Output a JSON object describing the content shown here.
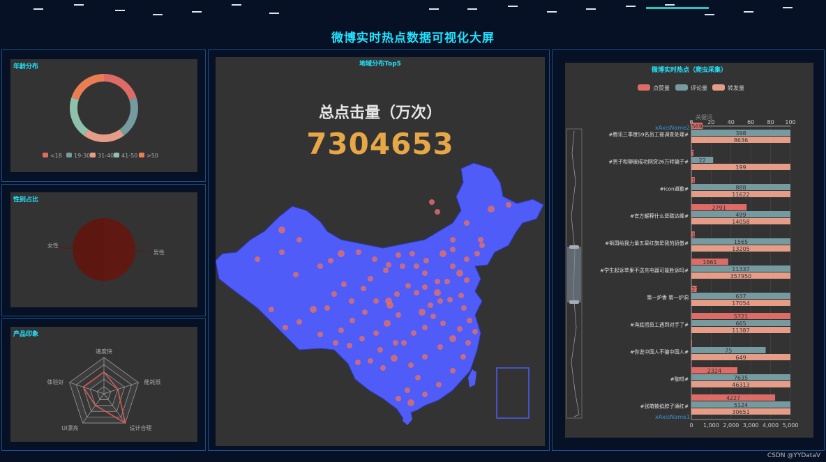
{
  "header": {
    "title": "微博实时热点数据可视化大屏"
  },
  "panels": {
    "age": {
      "title": "年龄分布"
    },
    "gender": {
      "title": "性别占比"
    },
    "impression": {
      "title": "产品印象"
    },
    "map": {
      "title": "地域分布Top5",
      "big_title": "总点击量（万次）",
      "big_number": "7304653"
    },
    "hot": {
      "title": "微博实时热点（爬虫采集）"
    }
  },
  "watermark": "CSDN @YYDataV",
  "colors": {
    "accent": "#1fe3ff",
    "panel_border": "#1b4f86",
    "map_fill": "#4f5cf8",
    "scatter": "#d96f6f",
    "number": "#e8a746"
  },
  "chart_data": [
    {
      "type": "pie",
      "id": "age",
      "variant": "donut",
      "categories": [
        "<18",
        "19-30",
        "31-40",
        "41-50",
        ">50"
      ],
      "values": [
        20,
        20,
        20,
        20,
        20
      ],
      "colors": [
        "#dd6b66",
        "#759aa0",
        "#e69d87",
        "#8dc1a9",
        "#ea7e53"
      ],
      "legend": "bottom"
    },
    {
      "type": "pie",
      "id": "gender",
      "categories": [
        "女性",
        "男性"
      ],
      "values": [
        50,
        50
      ],
      "colors": [
        "#5c1710",
        "#5f1812"
      ]
    },
    {
      "type": "radar",
      "id": "impression",
      "indicators": [
        "速度快",
        "能耗低",
        "设计合理",
        "UI漂亮",
        "体验好"
      ],
      "values": [
        3,
        2,
        5,
        2,
        3
      ],
      "max": 5
    },
    {
      "type": "scatter",
      "id": "map",
      "note": "scatter points over a map region"
    },
    {
      "type": "bar",
      "id": "hot",
      "orientation": "horizontal",
      "legend": "top",
      "xAxisName1": "xAxisName1",
      "xAxisName2": "xAxisName2",
      "yAxisName": "关键词",
      "bottom_ticks": [
        "0",
        "1,000",
        "2,000",
        "3,000",
        "4,000",
        "5,000"
      ],
      "top_ticks": [
        "0",
        "20",
        "40",
        "60",
        "80",
        "100"
      ],
      "categories": [
        "#腾讯三季度59名员工被调查处理#",
        "#男子和聊被成功网贷26万转骗子#",
        "#icon道歉#",
        "#官方解释什么是碳达峰#",
        "#祖国给我力量五星红旗是我的骄傲#",
        "#学生起诉苹果不送充电器可能胜诉吗#",
        "第一炉香 第一炉洞",
        "#海底捞员工遇到对手了#",
        "#你说中国人不骗中国人#",
        "#咖啡#",
        "#张萌被掐脖子通红#"
      ],
      "series": [
        {
          "name": "点赞量",
          "color": "#dd6b66",
          "values": [
            569,
            128,
            170,
            2791,
            167,
            1861,
            274,
            5721,
            12,
            2324,
            4227
          ]
        },
        {
          "name": "评论量",
          "color": "#759aa0",
          "values": [
            398,
            22,
            888,
            499,
            1565,
            11337,
            637,
            665,
            75,
            7635,
            5124
          ]
        },
        {
          "name": "转发量",
          "color": "#e69d87",
          "values": [
            8636,
            199,
            11622,
            14058,
            13205,
            357950,
            17054,
            11387,
            649,
            46313,
            30651
          ]
        }
      ]
    }
  ]
}
